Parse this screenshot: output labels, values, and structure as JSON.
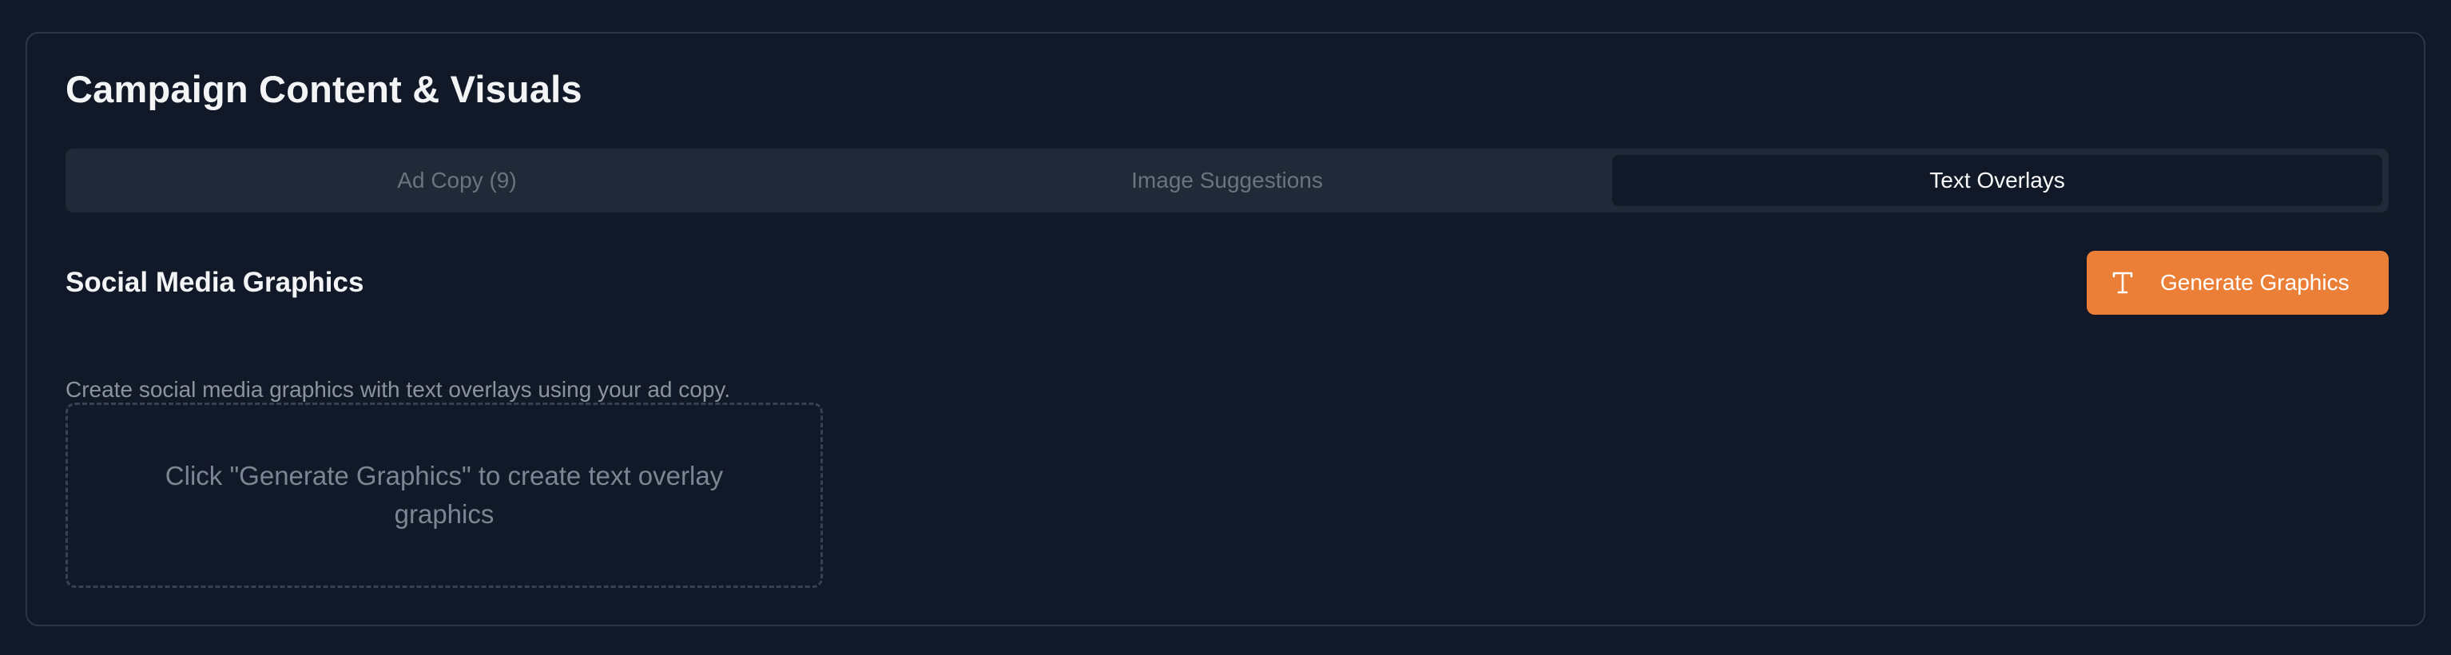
{
  "card": {
    "title": "Campaign Content & Visuals"
  },
  "tabs": [
    {
      "label": "Ad Copy (9)",
      "active": false
    },
    {
      "label": "Image Suggestions",
      "active": false
    },
    {
      "label": "Text Overlays",
      "active": true
    }
  ],
  "section": {
    "title": "Social Media Graphics",
    "description": "Create social media graphics with text overlays using your ad copy.",
    "generate_button": {
      "label": "Generate Graphics",
      "icon": "text-type-icon",
      "color": "#ec7f37"
    },
    "empty_state": "Click \"Generate Graphics\" to create text overlay graphics"
  },
  "colors": {
    "background": "#111827",
    "tab_bar": "#1f2937",
    "accent": "#ec7f37"
  }
}
